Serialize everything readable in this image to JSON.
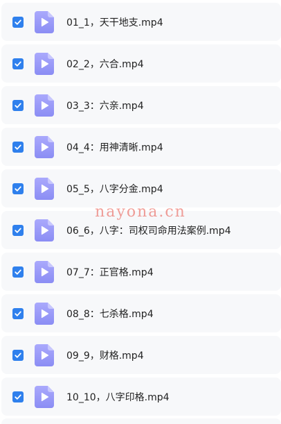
{
  "files": [
    {
      "name": "01_1，天干地支.mp4",
      "checked": true,
      "icon": "video-file-icon"
    },
    {
      "name": "02_2，六合.mp4",
      "checked": true,
      "icon": "video-file-icon"
    },
    {
      "name": "03_3：六亲.mp4",
      "checked": true,
      "icon": "video-file-icon"
    },
    {
      "name": "04_4：用神清晰.mp4",
      "checked": true,
      "icon": "video-file-icon"
    },
    {
      "name": "05_5，八字分金.mp4",
      "checked": true,
      "icon": "video-file-icon"
    },
    {
      "name": "06_6，八字：司权司命用法案例.mp4",
      "checked": true,
      "icon": "video-file-icon"
    },
    {
      "name": "07_7：正官格.mp4",
      "checked": true,
      "icon": "video-file-icon"
    },
    {
      "name": "08_8：七杀格.mp4",
      "checked": true,
      "icon": "video-file-icon"
    },
    {
      "name": "09_9，财格.mp4",
      "checked": true,
      "icon": "video-file-icon"
    },
    {
      "name": "10_10，八字印格.mp4",
      "checked": true,
      "icon": "video-file-icon"
    }
  ],
  "watermark": "nayona.cn",
  "colors": {
    "checkbox": "#2f80ed",
    "icon_top": "#a7a6fb",
    "icon_bottom": "#8c8ef5",
    "row_bg": "#f7f8fa",
    "text": "#222222"
  }
}
